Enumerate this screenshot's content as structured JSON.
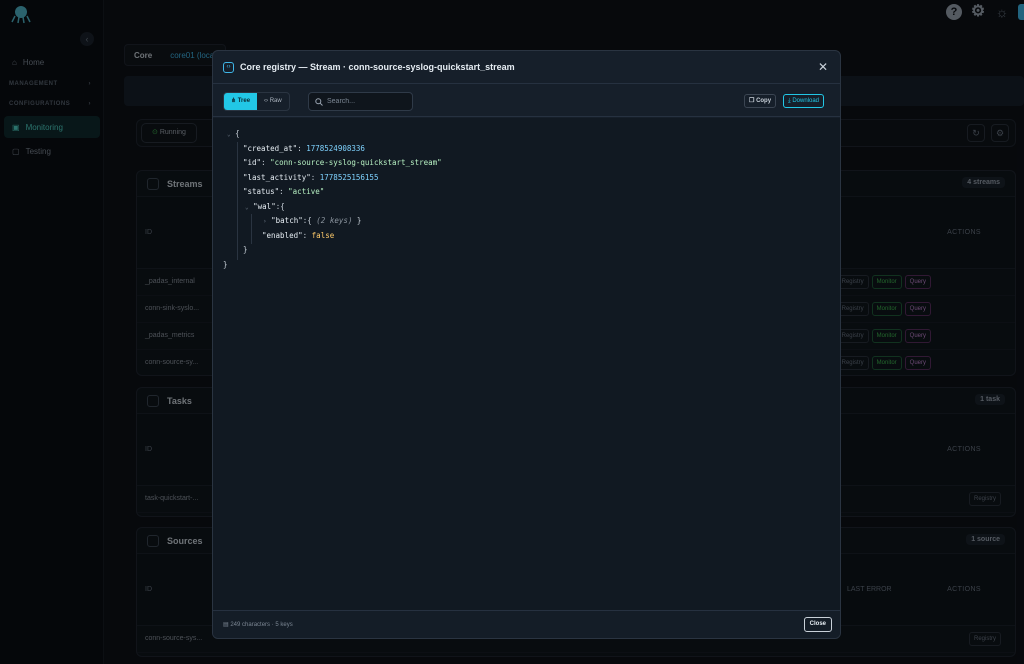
{
  "sidebar": {
    "items": [
      {
        "label": "Home"
      },
      {
        "label": "Monitoring"
      },
      {
        "label": "Testing"
      }
    ],
    "sections": [
      "MANAGEMENT",
      "CONFIGURATIONS"
    ]
  },
  "breadcrumb": [
    "Core",
    "core01 (local"
  ],
  "status": {
    "label": "Running"
  },
  "streams_card": {
    "title": "Streams",
    "count": "4 streams",
    "header_id": "ID",
    "header_actions": "ACTIONS",
    "rows": [
      "_padas_internal",
      "conn-sink-syslo...",
      "_padas_metrics",
      "conn-source-sy..."
    ],
    "btn_registry": "Registry",
    "btn_monitor": "Monitor",
    "btn_query": "Query"
  },
  "tasks_card": {
    "title": "Tasks",
    "count": "1 task",
    "header_id": "ID",
    "header_actions": "ACTIONS",
    "rows": [
      "task-quickstart-..."
    ],
    "btn_registry": "Registry"
  },
  "sources_card": {
    "title": "Sources",
    "count": "1 source",
    "header_id": "ID",
    "header_last_error": "LAST ERROR",
    "header_actions": "ACTIONS",
    "rows": [
      "conn-source-sys..."
    ],
    "btn_registry": "Registry"
  },
  "modal": {
    "title": "Core registry — Stream · conn-source-syslog-quickstart_stream",
    "view_tree": "Tree",
    "view_raw": "Raw",
    "search_placeholder": "Search...",
    "copy": "Copy",
    "download": "Download",
    "footer_info": "249 characters · 5 keys",
    "close": "Close",
    "json": {
      "open_brace": "{",
      "created_at_key": "\"created_at\"",
      "created_at_val": "1778524908336",
      "id_key": "\"id\"",
      "id_val": "\"conn-source-syslog-quickstart_stream\"",
      "last_activity_key": "\"last_activity\"",
      "last_activity_val": "1778525156155",
      "status_key": "\"status\"",
      "status_val": "\"active\"",
      "wal_key": "\"wal\"",
      "batch_key": "\"batch\"",
      "batch_meta": "(2 keys)",
      "enabled_key": "\"enabled\"",
      "enabled_val": "false",
      "close_brace": "}"
    }
  },
  "colors": {
    "accent": "#22c7e6",
    "monitor": "#3fb950",
    "query": "#c285d1"
  }
}
